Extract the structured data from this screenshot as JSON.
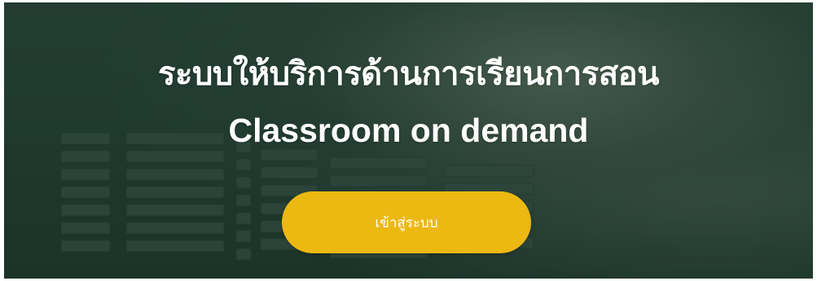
{
  "hero": {
    "title_th": "ระบบให้บริการด้านการเรียนการสอน",
    "title_en": "Classroom on demand",
    "login_button": "เข้าสู่ระบบ"
  },
  "colors": {
    "button_bg": "#ecb812",
    "text": "#ffffff",
    "overlay": "#1f3a2e"
  }
}
